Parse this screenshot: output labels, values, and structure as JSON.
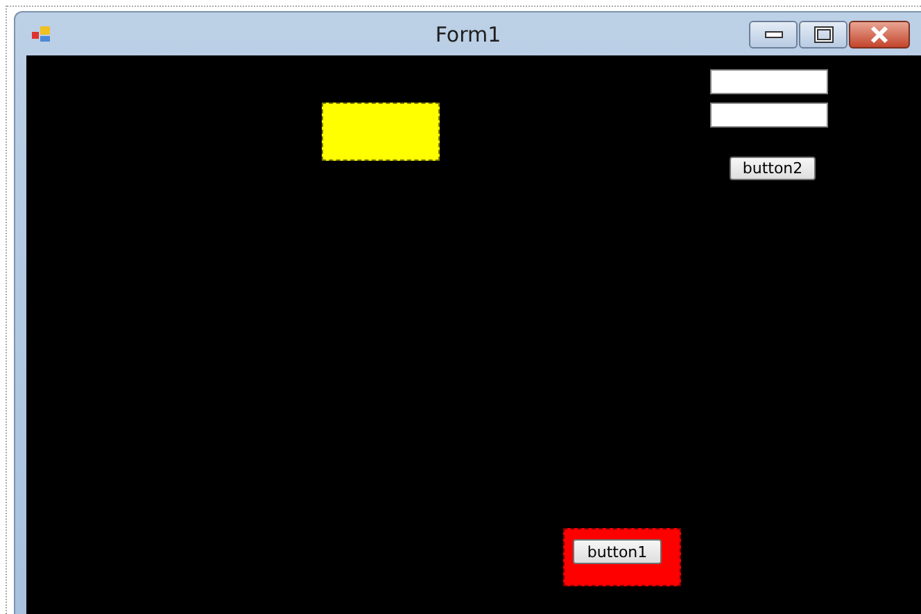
{
  "window": {
    "title": "Form1"
  },
  "controls": [
    {
      "kind": "panel",
      "color": "#ffff00"
    },
    {
      "kind": "textbox"
    },
    {
      "kind": "textbox"
    },
    {
      "kind": "button",
      "label": "button2"
    },
    {
      "kind": "panel",
      "color": "#ff0000",
      "children": [
        {
          "kind": "button",
          "label": "button1"
        }
      ]
    }
  ]
}
